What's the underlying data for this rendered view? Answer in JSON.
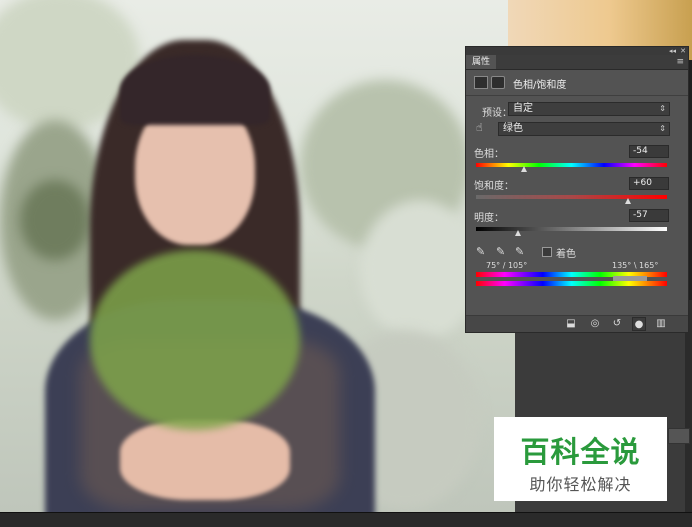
{
  "panel": {
    "tab_title": "属性",
    "collapse_glyph": "◂◂",
    "close_glyph": "✕",
    "menu_glyph": "≡",
    "header_title": "色相/饱和度",
    "preset_label": "预设：",
    "preset_value": "自定",
    "channel_value": "绿色",
    "hue_label": "色相：",
    "hue_value": "-54",
    "saturation_label": "饱和度：",
    "saturation_value": "+60",
    "lightness_label": "明度：",
    "lightness_value": "-57",
    "colorize_label": "着色",
    "range_left": "75° / 105°",
    "range_right": "135° \\ 165°",
    "icons": [
      "adjustment-layer-icon",
      "mask-icon",
      "hand-tool-icon",
      "eyedropper-icon",
      "eyedropper-plus-icon",
      "eyedropper-minus-icon",
      "clip-to-layer-icon",
      "visibility-eye-icon",
      "reset-icon",
      "eye-icon",
      "trash-icon"
    ]
  },
  "watermark": {
    "title": "百科全说",
    "subtitle": "助你轻松解决",
    "title_color": "#2a9a3c"
  }
}
